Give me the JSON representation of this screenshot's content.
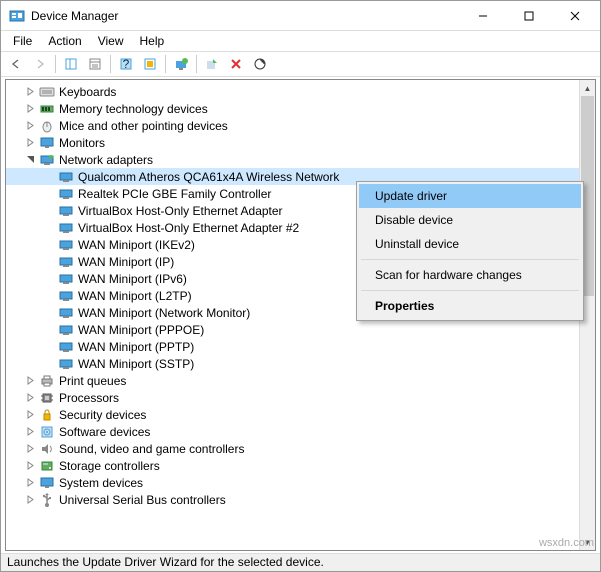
{
  "title": "Device Manager",
  "menubar": [
    "File",
    "Action",
    "View",
    "Help"
  ],
  "tree": {
    "categories": [
      {
        "label": "Keyboards",
        "expanded": false,
        "icon": "keyboard"
      },
      {
        "label": "Memory technology devices",
        "expanded": false,
        "icon": "memory"
      },
      {
        "label": "Mice and other pointing devices",
        "expanded": false,
        "icon": "mouse"
      },
      {
        "label": "Monitors",
        "expanded": false,
        "icon": "monitor"
      },
      {
        "label": "Network adapters",
        "expanded": true,
        "icon": "network",
        "children": [
          {
            "label": "Qualcomm Atheros QCA61x4A Wireless Network",
            "selected": true
          },
          {
            "label": "Realtek PCIe GBE Family Controller"
          },
          {
            "label": "VirtualBox Host-Only Ethernet Adapter"
          },
          {
            "label": "VirtualBox Host-Only Ethernet Adapter #2"
          },
          {
            "label": "WAN Miniport (IKEv2)"
          },
          {
            "label": "WAN Miniport (IP)"
          },
          {
            "label": "WAN Miniport (IPv6)"
          },
          {
            "label": "WAN Miniport (L2TP)"
          },
          {
            "label": "WAN Miniport (Network Monitor)"
          },
          {
            "label": "WAN Miniport (PPPOE)"
          },
          {
            "label": "WAN Miniport (PPTP)"
          },
          {
            "label": "WAN Miniport (SSTP)"
          }
        ]
      },
      {
        "label": "Print queues",
        "expanded": false,
        "icon": "printer"
      },
      {
        "label": "Processors",
        "expanded": false,
        "icon": "cpu"
      },
      {
        "label": "Security devices",
        "expanded": false,
        "icon": "security"
      },
      {
        "label": "Software devices",
        "expanded": false,
        "icon": "software"
      },
      {
        "label": "Sound, video and game controllers",
        "expanded": false,
        "icon": "sound"
      },
      {
        "label": "Storage controllers",
        "expanded": false,
        "icon": "storage"
      },
      {
        "label": "System devices",
        "expanded": false,
        "icon": "system"
      },
      {
        "label": "Universal Serial Bus controllers",
        "expanded": false,
        "icon": "usb"
      }
    ]
  },
  "context_menu": {
    "items": [
      {
        "label": "Update driver",
        "highlight": true
      },
      {
        "label": "Disable device"
      },
      {
        "label": "Uninstall device"
      },
      {
        "sep": true
      },
      {
        "label": "Scan for hardware changes"
      },
      {
        "sep": true
      },
      {
        "label": "Properties",
        "bold": true
      }
    ]
  },
  "statusbar": "Launches the Update Driver Wizard for the selected device.",
  "watermark": "wsxdn.com",
  "colors": {
    "selection": "#cde8ff",
    "menu_highlight": "#91c9f7"
  }
}
